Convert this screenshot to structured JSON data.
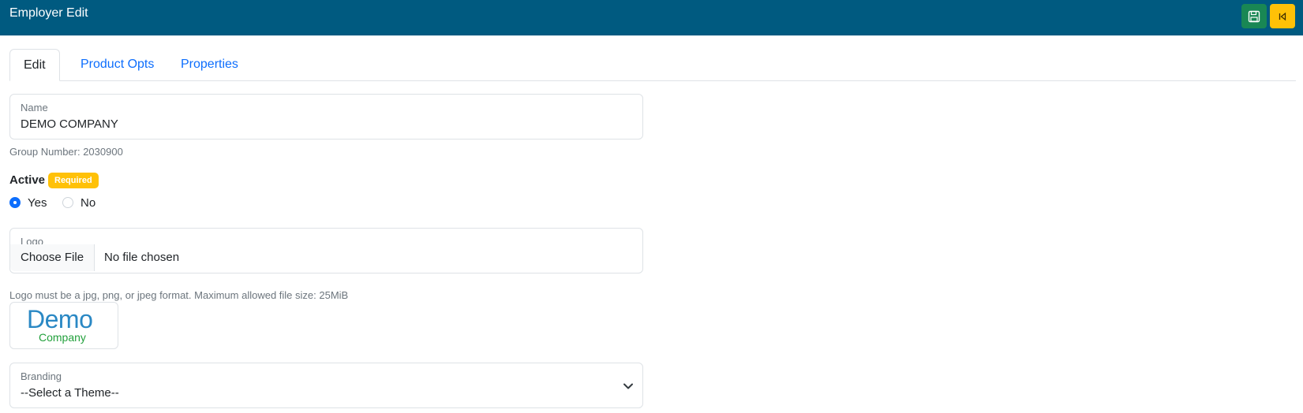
{
  "header": {
    "title": "Employer Edit",
    "save_icon": "floppy-disk-icon",
    "back_icon": "back-arrow-icon",
    "save_color": "#198754",
    "back_color": "#ffc107",
    "bg_color": "#005a80"
  },
  "tabs": [
    {
      "label": "Edit",
      "active": true
    },
    {
      "label": "Product Opts",
      "active": false
    },
    {
      "label": "Properties",
      "active": false
    }
  ],
  "form": {
    "name": {
      "label": "Name",
      "value": "DEMO COMPANY"
    },
    "group_number": "Group Number: 2030900",
    "active": {
      "label": "Active",
      "badge": "Required",
      "options": [
        {
          "label": "Yes",
          "checked": true
        },
        {
          "label": "No",
          "checked": false
        }
      ]
    },
    "logo": {
      "label": "Logo",
      "button_label": "Choose File",
      "status": "No file chosen",
      "help": "Logo must be a jpg, png, or jpeg format. Maximum allowed file size: 25MiB",
      "preview_main": "Demo",
      "preview_sub": "Company"
    },
    "branding": {
      "label": "Branding",
      "value": "--Select a Theme--"
    }
  }
}
